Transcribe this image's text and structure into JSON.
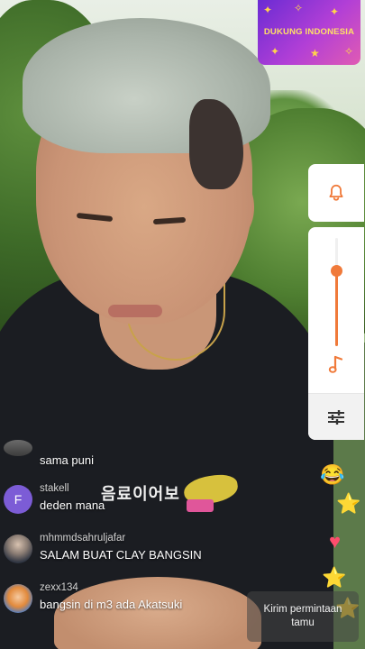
{
  "promo": {
    "text": "DUKUNG INDONESIA",
    "colors": {
      "bg_start": "#6a2bd3",
      "bg_end": "#e05bb3",
      "text": "#ffe066"
    }
  },
  "panel": {
    "bell_icon": "bell-icon",
    "volume_level": 0.7,
    "music_icon": "music-note-icon",
    "settings_icon": "sliders-icon",
    "accent": "#f07a3a"
  },
  "chat": {
    "messages": [
      {
        "username": "",
        "text": "sama puni",
        "avatar": "partial-avatar"
      },
      {
        "username": "stakell",
        "text": "deden mana",
        "avatar_letter": "F",
        "avatar_color": "#7c5cd6"
      },
      {
        "username": "mhmmdsahruljafar",
        "text": "SALAM BUAT CLAY BANGSIN",
        "avatar": "photo-avatar"
      },
      {
        "username": "zexx134",
        "text": "bangsin di m3 ada Akatsuki",
        "avatar": "anime-avatar"
      }
    ]
  },
  "gifts": [
    "laughing-face-icon",
    "star-gift-icon",
    "heart-gift-icon",
    "star-gift-icon",
    "star-gift-icon"
  ],
  "guest_button": {
    "line1": "Kirim permintaan",
    "line2": "tamu"
  },
  "shirt_print": "음료이어보"
}
